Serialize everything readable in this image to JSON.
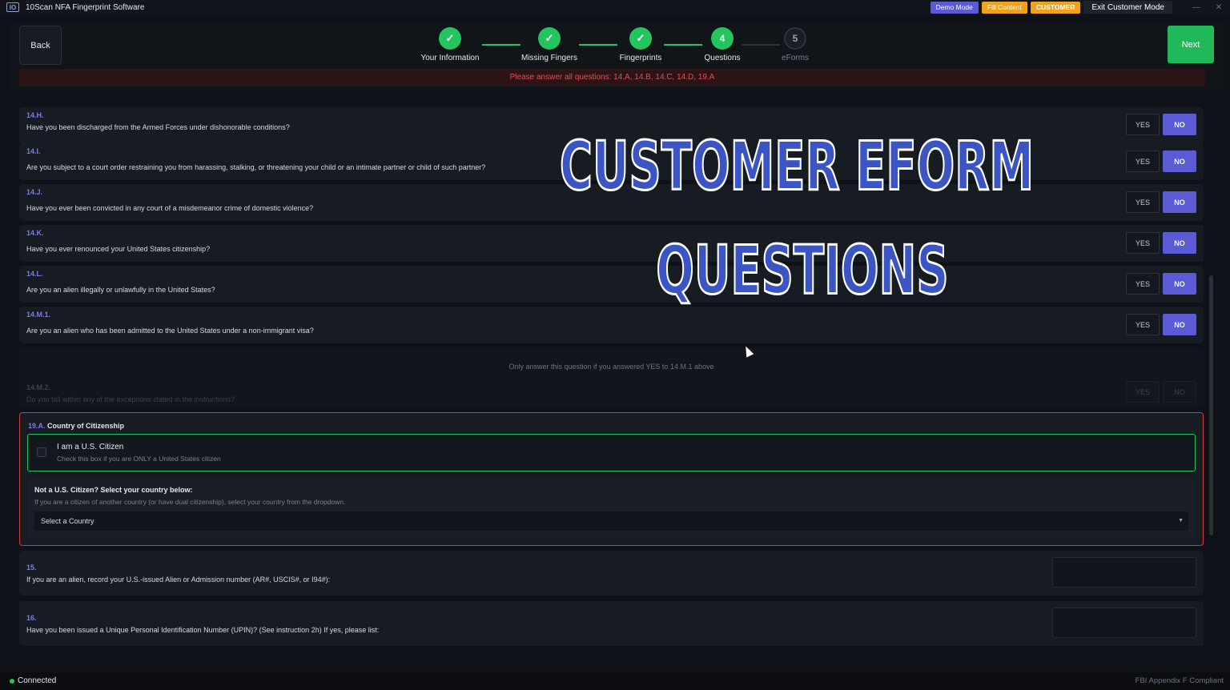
{
  "titlebar": {
    "app_title": "10Scan NFA Fingerprint Software",
    "logo_text": "IO",
    "demo_mode": "Demo Mode",
    "fill_content": "Fill Content",
    "customer": "CUSTOMER",
    "exit_customer_mode": "Exit Customer Mode",
    "minimize": "—",
    "close": "✕"
  },
  "nav": {
    "back": "Back",
    "next": "Next",
    "steps": [
      {
        "label": "Your Information",
        "state": "done",
        "mark": "✓"
      },
      {
        "label": "Missing Fingers",
        "state": "done",
        "mark": "✓"
      },
      {
        "label": "Fingerprints",
        "state": "done",
        "mark": "✓"
      },
      {
        "label": "Questions",
        "state": "active",
        "mark": "4"
      },
      {
        "label": "eForms",
        "state": "todo",
        "mark": "5"
      }
    ]
  },
  "warning": "Please answer all questions: 14.A, 14.B, 14.C, 14.D, 19.A",
  "questions": [
    {
      "num": "14.H.",
      "text": "Have you been discharged from the Armed Forces under dishonorable conditions?",
      "yes": "YES",
      "no": "NO"
    },
    {
      "num": "14.I.",
      "text": "Are you subject to a court order restraining you from harassing, stalking, or threatening your child or an intimate partner or child of such partner?",
      "yes": "YES",
      "no": "NO"
    },
    {
      "num": "14.J.",
      "text": "Have you ever been convicted in any court of a misdemeanor crime of domestic violence?",
      "yes": "YES",
      "no": "NO"
    },
    {
      "num": "14.K.",
      "text": "Have you ever renounced your United States citizenship?",
      "yes": "YES",
      "no": "NO"
    },
    {
      "num": "14.L.",
      "text": "Are you an alien illegally or unlawfully in the United States?",
      "yes": "YES",
      "no": "NO"
    },
    {
      "num": "14.M.1.",
      "text": "Are you an alien who has been admitted to the United States under a non-immigrant visa?",
      "yes": "YES",
      "no": "NO"
    }
  ],
  "q14m2": {
    "note": "Only answer this question if you answered YES to 14.M.1 above",
    "num": "14.M.2.",
    "text": "Do you fall within any of the exceptions stated in the instructions?",
    "yes": "YES",
    "no": "NO"
  },
  "citizenship": {
    "num": "19.A.",
    "title": "Country of Citizenship",
    "us_label": "I am a U.S. Citizen",
    "us_sub": "Check this box if you are ONLY a United States citizen",
    "notus_title": "Not a U.S. Citizen? Select your country below:",
    "notus_sub": "If you are a citizen of another country (or have dual citizenship), select your country from the dropdown.",
    "select_value": "Select a Country"
  },
  "q15": {
    "num": "15.",
    "text": "If you are an alien, record your U.S.-issued Alien or Admission number (AR#, USCIS#, or I94#):"
  },
  "q16": {
    "num": "16.",
    "text": "Have you been issued a Unique Personal Identification Number (UPIN)? (See instruction 2h) If yes, please list:"
  },
  "status": {
    "connected": "Connected",
    "compliant": "FBI Appendix F Compliant"
  },
  "overlay": {
    "line1": "CUSTOMER EFORM",
    "line2": "QUESTIONS"
  },
  "colors": {
    "accent": "#5b5bd6",
    "success": "#22c55e",
    "warning": "#e05050",
    "orange": "#f0a21a"
  }
}
